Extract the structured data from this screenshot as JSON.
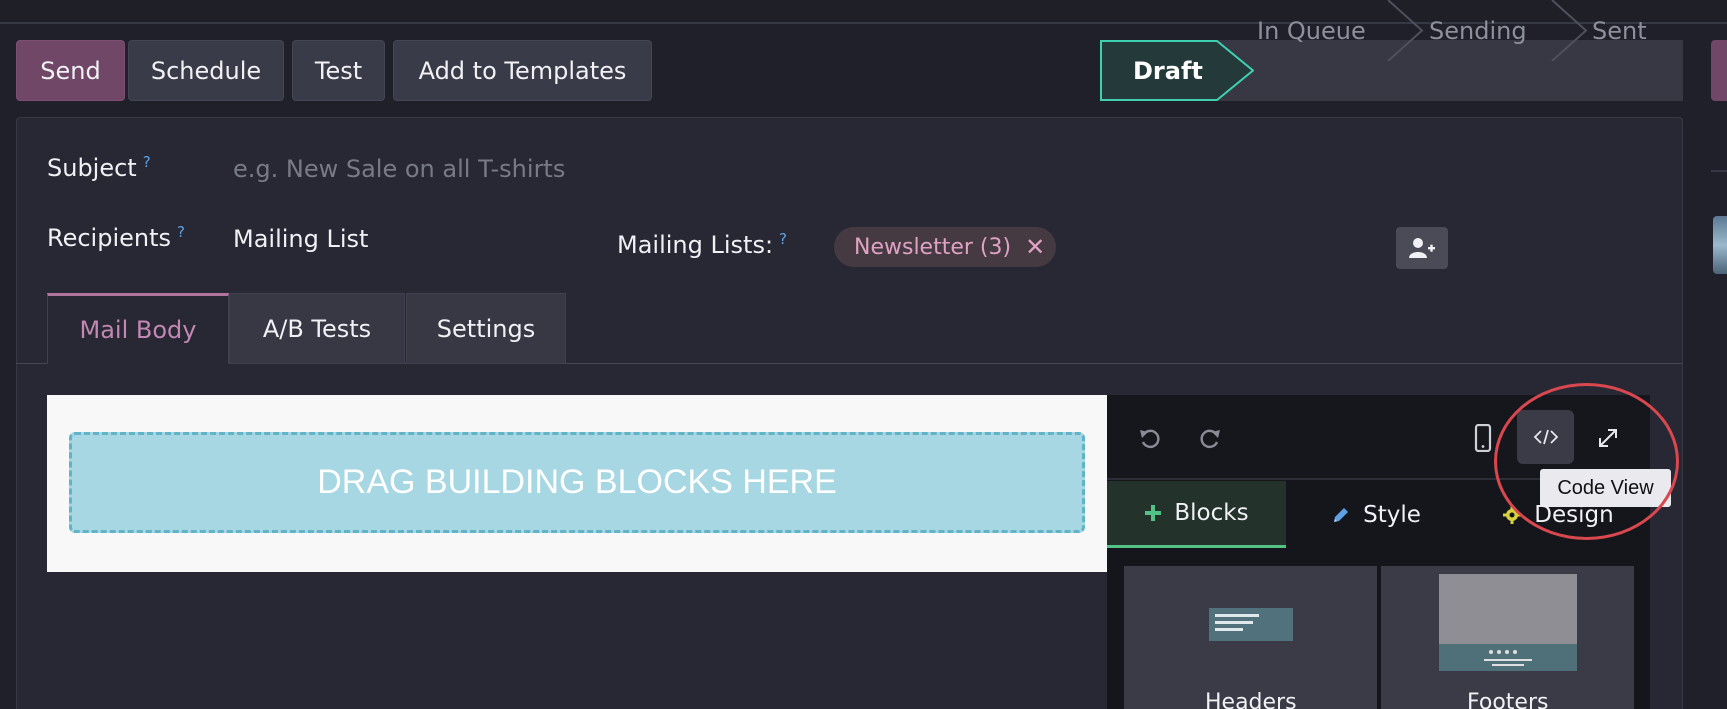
{
  "actions": {
    "send": "Send",
    "schedule": "Schedule",
    "test": "Test",
    "add_templates": "Add to Templates"
  },
  "status": {
    "steps": [
      "Draft",
      "In Queue",
      "Sending",
      "Sent"
    ],
    "active": "Draft"
  },
  "form": {
    "subject_label": "Subject",
    "subject_placeholder": "e.g. New Sale on all T-shirts",
    "recipients_label": "Recipients",
    "recipients_value": "Mailing List",
    "mailing_lists_label": "Mailing Lists:",
    "help_mark": "?",
    "mailing_list_tag": "Newsletter (3)",
    "tag_remove": "✕"
  },
  "tabs": [
    "Mail Body",
    "A/B Tests",
    "Settings"
  ],
  "editor": {
    "dropzone_text": "DRAG BUILDING BLOCKS HERE",
    "tooltip": "Code View",
    "side_tabs": [
      "Blocks",
      "Style",
      "Design"
    ],
    "blocks": [
      "Headers",
      "Footers"
    ]
  },
  "colors": {
    "accent": "#704766",
    "status_active_border": "#3fd0b0",
    "blocks_tab_accent": "#52c285",
    "annotation_circle": "#d9474f"
  },
  "icons": {
    "undo": "undo-icon",
    "redo": "redo-icon",
    "mobile": "mobile-icon",
    "code": "code-icon",
    "fullscreen": "expand-icon",
    "add_contact": "user-plus-icon"
  }
}
